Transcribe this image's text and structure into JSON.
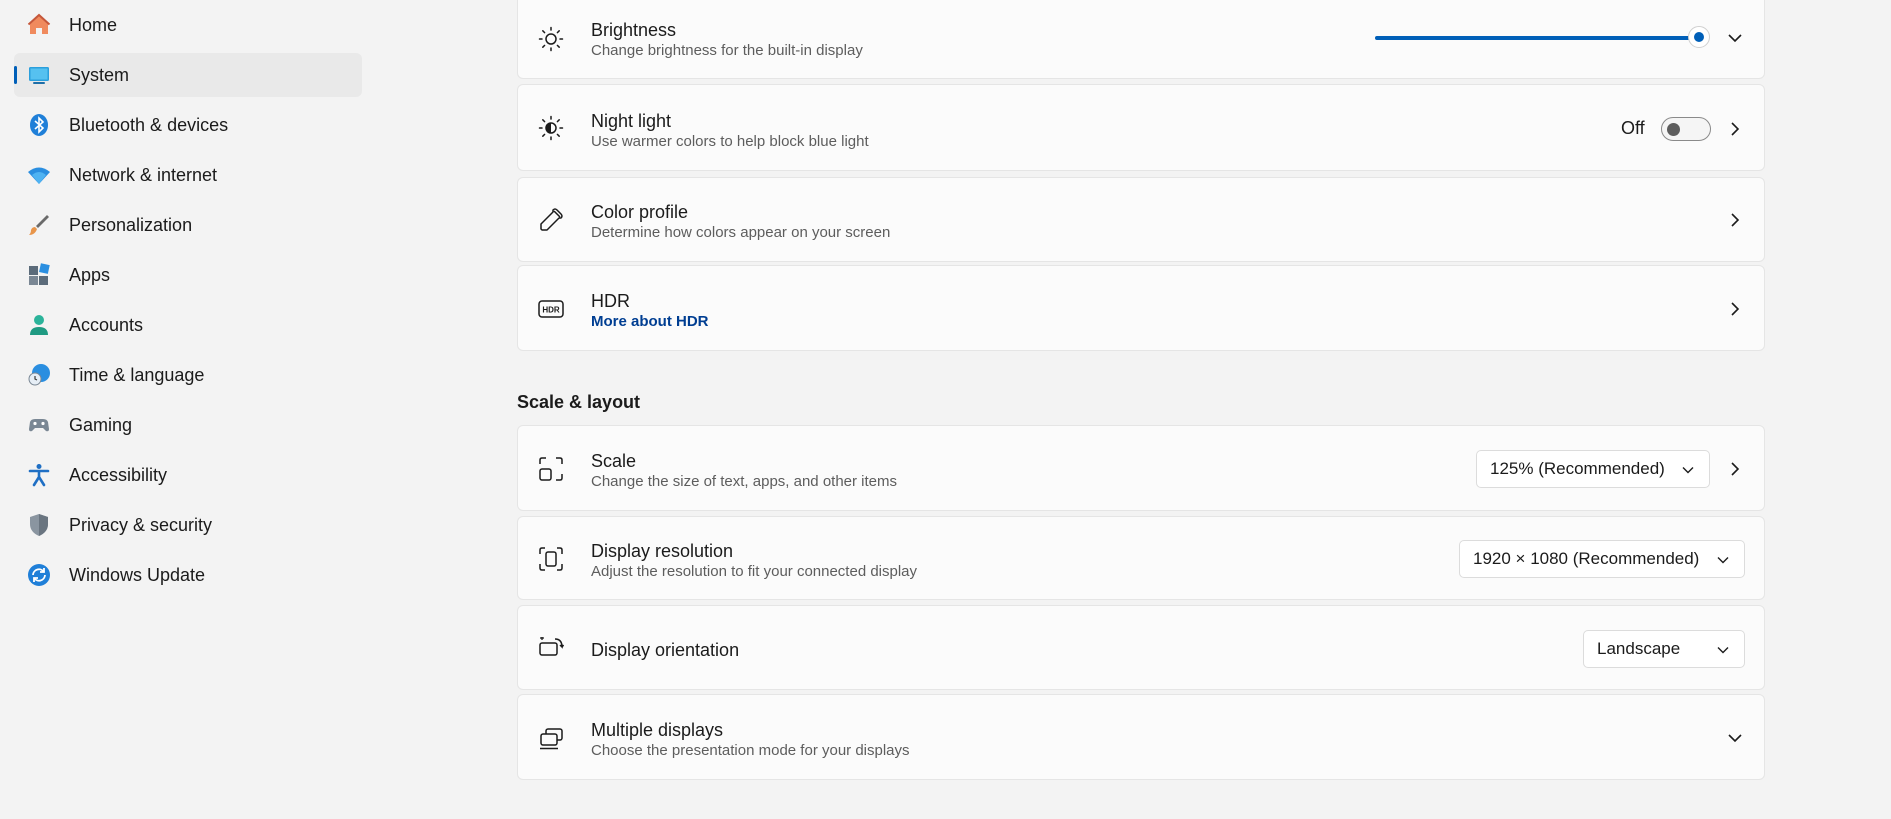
{
  "sidebar": {
    "items": [
      {
        "label": "Home",
        "icon": "home-icon"
      },
      {
        "label": "System",
        "icon": "system-icon",
        "active": true
      },
      {
        "label": "Bluetooth & devices",
        "icon": "bluetooth-icon"
      },
      {
        "label": "Network & internet",
        "icon": "wifi-icon"
      },
      {
        "label": "Personalization",
        "icon": "brush-icon"
      },
      {
        "label": "Apps",
        "icon": "apps-icon"
      },
      {
        "label": "Accounts",
        "icon": "account-icon"
      },
      {
        "label": "Time & language",
        "icon": "globe-clock-icon"
      },
      {
        "label": "Gaming",
        "icon": "gamepad-icon"
      },
      {
        "label": "Accessibility",
        "icon": "accessibility-icon"
      },
      {
        "label": "Privacy & security",
        "icon": "shield-icon"
      },
      {
        "label": "Windows Update",
        "icon": "update-icon"
      }
    ]
  },
  "brightness": {
    "title": "Brightness",
    "subtitle": "Change brightness for the built-in display",
    "level_percent": 100
  },
  "night_light": {
    "title": "Night light",
    "subtitle": "Use warmer colors to help block blue light",
    "state": "Off"
  },
  "color_profile": {
    "title": "Color profile",
    "subtitle": "Determine how colors appear on your screen"
  },
  "hdr": {
    "title": "HDR",
    "link": "More about HDR"
  },
  "scale_layout": {
    "heading": "Scale & layout",
    "scale": {
      "title": "Scale",
      "subtitle": "Change the size of text, apps, and other items",
      "value": "125% (Recommended)"
    },
    "resolution": {
      "title": "Display resolution",
      "subtitle": "Adjust the resolution to fit your connected display",
      "value": "1920 × 1080 (Recommended)"
    },
    "orientation": {
      "title": "Display orientation",
      "value": "Landscape"
    },
    "multiple": {
      "title": "Multiple displays",
      "subtitle": "Choose the presentation mode for your displays"
    }
  },
  "colors": {
    "accent": "#005fb8",
    "link": "#003e92"
  }
}
